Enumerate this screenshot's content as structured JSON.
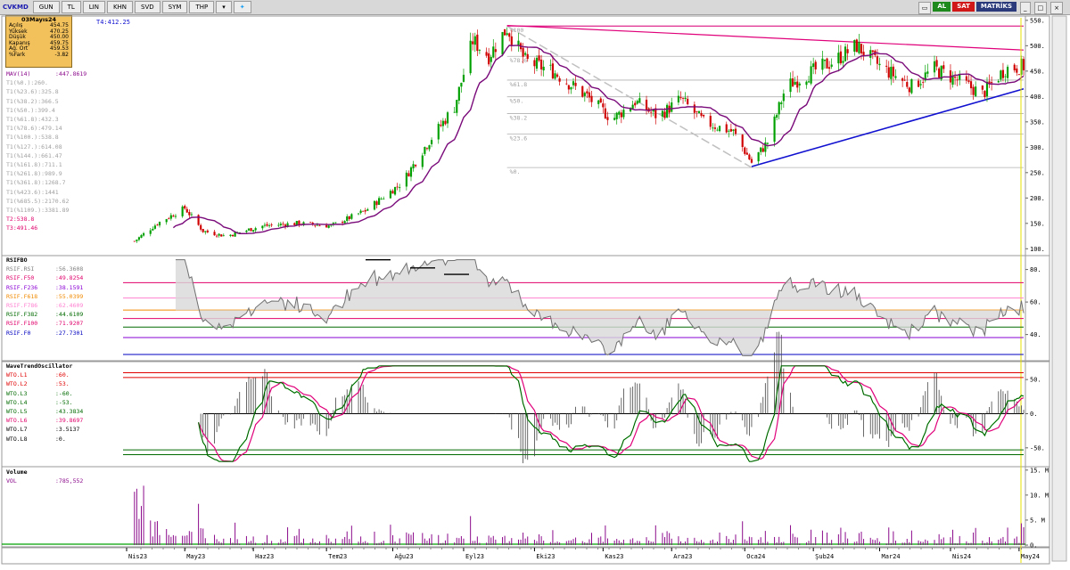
{
  "toolbar": {
    "symbol": "CVKMD",
    "buttons": [
      "GUN",
      "TL",
      "LIN",
      "KHN",
      "SVD",
      "SYM",
      "THP"
    ],
    "al_label": "AL",
    "sat_label": "SAT",
    "brand": "MATRİKS"
  },
  "info": {
    "date": "03Mayıs24",
    "rows": [
      {
        "k": "Açılış",
        "v": "454.75"
      },
      {
        "k": "Yüksek",
        "v": "470.25"
      },
      {
        "k": "Düşük",
        "v": "450.00"
      },
      {
        "k": "Kapanış",
        "v": "459.75"
      },
      {
        "k": "Ağ. Ort",
        "v": "459.53"
      },
      {
        "k": "%Fark",
        "v": "-3.82"
      }
    ]
  },
  "t4_label": "T4:412.25",
  "price_legend": [
    {
      "text": "MAV(14)",
      "value": ":447.8619",
      "color": "#8b0a8b"
    },
    {
      "text": "T1(%0.):260.",
      "value": "",
      "color": "#a0a0a0"
    },
    {
      "text": "T1(%23.6):325.8",
      "value": "",
      "color": "#a0a0a0"
    },
    {
      "text": "T1(%38.2):366.5",
      "value": "",
      "color": "#a0a0a0"
    },
    {
      "text": "T1(%50.):399.4",
      "value": "",
      "color": "#a0a0a0"
    },
    {
      "text": "T1(%61.8):432.3",
      "value": "",
      "color": "#a0a0a0"
    },
    {
      "text": "T1(%78.6):479.14",
      "value": "",
      "color": "#a0a0a0"
    },
    {
      "text": "T1(%100.):538.8",
      "value": "",
      "color": "#a0a0a0"
    },
    {
      "text": "T1(%127.):614.08",
      "value": "",
      "color": "#a0a0a0"
    },
    {
      "text": "T1(%144.):661.47",
      "value": "",
      "color": "#a0a0a0"
    },
    {
      "text": "T1(%161.8):711.1",
      "value": "",
      "color": "#a0a0a0"
    },
    {
      "text": "T1(%261.8):989.9",
      "value": "",
      "color": "#a0a0a0"
    },
    {
      "text": "T1(%361.8):1268.7",
      "value": "",
      "color": "#a0a0a0"
    },
    {
      "text": "T1(%423.6):1441",
      "value": "",
      "color": "#a0a0a0"
    },
    {
      "text": "T1(%685.5):2170.62",
      "value": "",
      "color": "#a0a0a0"
    },
    {
      "text": "T1(%1109.):3381.89",
      "value": "",
      "color": "#a0a0a0"
    },
    {
      "text": "T2:538.8",
      "value": "",
      "color": "#e0006a"
    },
    {
      "text": "T3:491.46",
      "value": "",
      "color": "#e0006a"
    }
  ],
  "rsi_legend": [
    {
      "text": "RSIFBO",
      "value": "",
      "color": "#000000"
    },
    {
      "text": "RSIF.RSI",
      "value": ":56.3608",
      "color": "#808080"
    },
    {
      "text": "RSIF.F50",
      "value": ":49.8254",
      "color": "#e0006a"
    },
    {
      "text": "RSIF.F236",
      "value": ":38.1591",
      "color": "#8a00d4"
    },
    {
      "text": "RSIF.F618",
      "value": ":55.0399",
      "color": "#f08a00"
    },
    {
      "text": "RSIF.F786",
      "value": ":62.4609",
      "color": "#ff80d0"
    },
    {
      "text": "RSIF.F382",
      "value": ":44.6109",
      "color": "#006a00"
    },
    {
      "text": "RSIF.F100",
      "value": ":71.9207",
      "color": "#e0006a"
    },
    {
      "text": "RSIF.F0",
      "value": ":27.7301",
      "color": "#0000c0"
    }
  ],
  "wto_legend": [
    {
      "text": "WaveTrendOscillator",
      "value": "",
      "color": "#000000"
    },
    {
      "text": "WTO.L1",
      "value": ":60.",
      "color": "#e00000"
    },
    {
      "text": "WTO.L2",
      "value": ":53.",
      "color": "#e00000"
    },
    {
      "text": "WTO.L3",
      "value": ":-60.",
      "color": "#006a00"
    },
    {
      "text": "WTO.L4",
      "value": ":-53.",
      "color": "#006a00"
    },
    {
      "text": "WTO.L5",
      "value": ":43.3834",
      "color": "#006a00"
    },
    {
      "text": "WTO.L6",
      "value": ":39.8697",
      "color": "#e0006a"
    },
    {
      "text": "WTO.L7",
      "value": ":3.5137",
      "color": "#000000"
    },
    {
      "text": "WTO.L8",
      "value": ":0.",
      "color": "#000000"
    }
  ],
  "vol_legend": [
    {
      "text": "Volume",
      "value": "",
      "color": "#000000"
    },
    {
      "text": "VOL",
      "value": ":785,552",
      "color": "#8b0a8b"
    }
  ],
  "fib_labels": [
    "%100",
    "%78.6",
    "%61.8",
    "%50.",
    "%38.2",
    "%23.6",
    "%0."
  ],
  "chart_data": {
    "type": "candlestick",
    "x_ticks": [
      "Nis23",
      "May23",
      "Haz23",
      "Tem23",
      "Ağu23",
      "Eyl23",
      "Eki23",
      "Kas23",
      "Ara23",
      "Oca24",
      "Şub24",
      "Mar24",
      "Nis24",
      "May24"
    ],
    "price_axis": {
      "ticks": [
        550,
        500,
        450,
        400,
        350,
        300,
        250,
        200,
        150,
        100
      ],
      "range": [
        90,
        555
      ]
    },
    "fib_levels": [
      538.8,
      479.14,
      432.3,
      399.4,
      366.5,
      325.8,
      260
    ],
    "price_anchors": [
      {
        "x": "2023-04-10",
        "y": 115
      },
      {
        "x": "2023-04-20",
        "y": 150
      },
      {
        "x": "2023-05-02",
        "y": 180
      },
      {
        "x": "2023-05-10",
        "y": 135
      },
      {
        "x": "2023-05-20",
        "y": 125
      },
      {
        "x": "2023-06-05",
        "y": 145
      },
      {
        "x": "2023-06-20",
        "y": 150
      },
      {
        "x": "2023-07-05",
        "y": 145
      },
      {
        "x": "2023-07-20",
        "y": 175
      },
      {
        "x": "2023-08-05",
        "y": 230
      },
      {
        "x": "2023-08-15",
        "y": 300
      },
      {
        "x": "2023-08-28",
        "y": 380
      },
      {
        "x": "2023-09-05",
        "y": 510
      },
      {
        "x": "2023-09-12",
        "y": 480
      },
      {
        "x": "2023-09-20",
        "y": 535
      },
      {
        "x": "2023-09-28",
        "y": 470
      },
      {
        "x": "2023-10-10",
        "y": 450
      },
      {
        "x": "2023-10-25",
        "y": 400
      },
      {
        "x": "2023-11-05",
        "y": 355
      },
      {
        "x": "2023-11-15",
        "y": 390
      },
      {
        "x": "2023-11-25",
        "y": 360
      },
      {
        "x": "2023-12-05",
        "y": 395
      },
      {
        "x": "2023-12-15",
        "y": 350
      },
      {
        "x": "2023-12-28",
        "y": 330
      },
      {
        "x": "2024-01-05",
        "y": 270
      },
      {
        "x": "2024-01-12",
        "y": 310
      },
      {
        "x": "2024-01-20",
        "y": 420
      },
      {
        "x": "2024-02-01",
        "y": 450
      },
      {
        "x": "2024-02-10",
        "y": 470
      },
      {
        "x": "2024-02-20",
        "y": 500
      },
      {
        "x": "2024-03-01",
        "y": 460
      },
      {
        "x": "2024-03-15",
        "y": 420
      },
      {
        "x": "2024-03-25",
        "y": 455
      },
      {
        "x": "2024-04-05",
        "y": 430
      },
      {
        "x": "2024-04-15",
        "y": 405
      },
      {
        "x": "2024-04-25",
        "y": 455
      },
      {
        "x": "2024-05-03",
        "y": 459.75
      }
    ],
    "rsi_axis": {
      "ticks": [
        80,
        60,
        40
      ],
      "range": [
        25,
        88
      ]
    },
    "rsi_levels": [
      {
        "name": "RSIF.F100",
        "value": 71.9207,
        "color": "#e0006a"
      },
      {
        "name": "RSIF.F786",
        "value": 62.4609,
        "color": "#ff80d0"
      },
      {
        "name": "RSIF.F618",
        "value": 55.0399,
        "color": "#f08a00"
      },
      {
        "name": "RSIF.F50",
        "value": 49.8254,
        "color": "#e0006a"
      },
      {
        "name": "RSIF.F382",
        "value": 44.6109,
        "color": "#006a00"
      },
      {
        "name": "RSIF.F236",
        "value": 38.1591,
        "color": "#8a00d4"
      },
      {
        "name": "RSIF.F0",
        "value": 27.7301,
        "color": "#0000c0"
      }
    ],
    "wto_axis": {
      "ticks": [
        50,
        0,
        -50
      ],
      "range": [
        -75,
        75
      ]
    },
    "wto_levels": [
      {
        "name": "WTO.L1",
        "value": 60,
        "color": "#e00000"
      },
      {
        "name": "WTO.L2",
        "value": 53,
        "color": "#e00000"
      },
      {
        "name": "WTO.L3",
        "value": -60,
        "color": "#006a00"
      },
      {
        "name": "WTO.L4",
        "value": -53,
        "color": "#006a00"
      }
    ],
    "vol_axis": {
      "ticks": [
        "15. M",
        "10. M",
        "5. M",
        "0."
      ],
      "range": [
        0,
        15.5
      ]
    },
    "last_volume": "785,552"
  },
  "colors": {
    "up": "#00a000",
    "down": "#d00000",
    "mav": "#7a0a7a",
    "trend_blue": "#1010d0",
    "trend_pink": "#e0007a",
    "fib": "#b0b0b0"
  }
}
